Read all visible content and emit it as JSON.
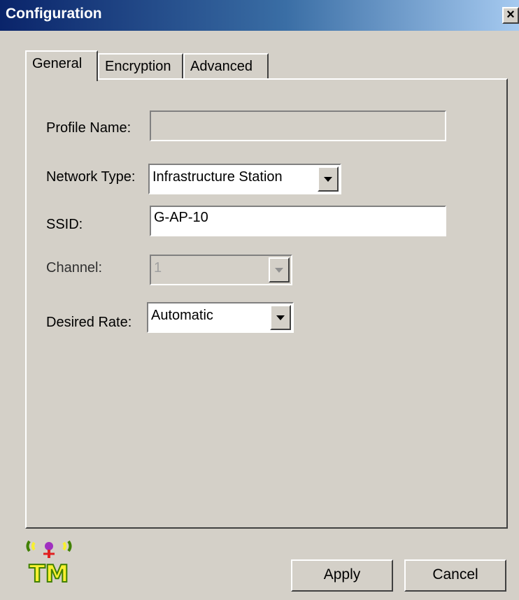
{
  "window": {
    "title": "Configuration",
    "close_glyph": "×"
  },
  "tabs": [
    {
      "label": "General",
      "active": true
    },
    {
      "label": "Encryption",
      "active": false
    },
    {
      "label": "Advanced",
      "active": false
    }
  ],
  "general": {
    "profile_name": {
      "label": "Profile Name:",
      "value": ""
    },
    "network_type": {
      "label": "Network Type:",
      "value": "Infrastructure Station"
    },
    "ssid": {
      "label": "SSID:",
      "value": "G-AP-10"
    },
    "channel": {
      "label": "Channel:",
      "value": "1",
      "disabled": true
    },
    "desired_rate": {
      "label": "Desired Rate:",
      "value": "Automatic"
    }
  },
  "footer": {
    "logo_text": "TM",
    "logo_icon": "wireless-antenna-icon",
    "apply_label": "Apply",
    "cancel_label": "Cancel"
  },
  "colors": {
    "titlebar_start": "#0a246a",
    "titlebar_end": "#a6caf0",
    "face": "#d4d0c8",
    "logo_fill": "#f8f030",
    "logo_outline": "#408000",
    "logo_antenna_red": "#e02020",
    "logo_antenna_purple": "#a030c0"
  }
}
